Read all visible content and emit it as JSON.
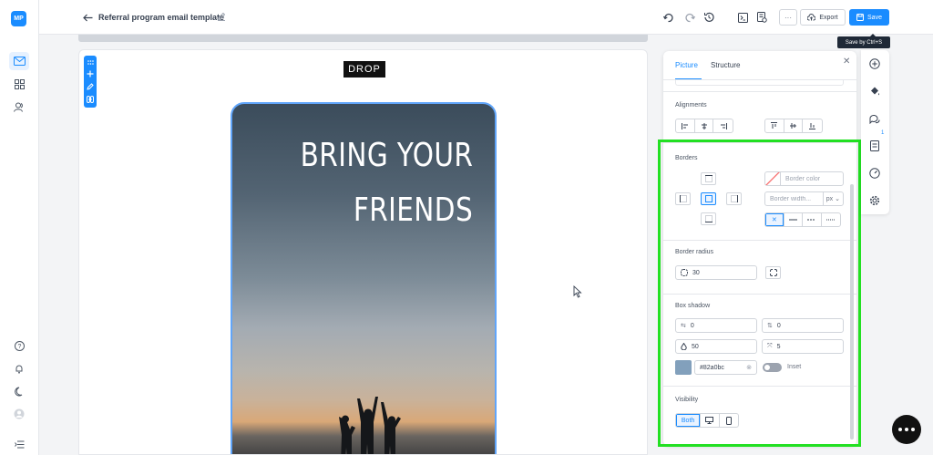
{
  "app": {
    "logo": "MP"
  },
  "header": {
    "title": "Referral program email template",
    "more_label": "···",
    "export_label": "Export",
    "save_label": "Save",
    "save_tooltip": "Save by Ctrl+S"
  },
  "canvas": {
    "logo_text": "DROP",
    "hero_line1": "BRING YOUR",
    "hero_line2": "FRIENDS"
  },
  "panel": {
    "tabs": [
      {
        "label": "Picture",
        "active": true
      },
      {
        "label": "Structure",
        "active": false
      }
    ],
    "alignments_label": "Alignments",
    "borders": {
      "label": "Borders",
      "color_placeholder": "Border color",
      "width_placeholder": "Border width...",
      "unit": "px"
    },
    "border_radius": {
      "label": "Border radius",
      "value": "30"
    },
    "box_shadow": {
      "label": "Box shadow",
      "h_offset": "0",
      "v_offset": "0",
      "blur": "50",
      "spread": "5",
      "color": "#82a0bc",
      "inset_label": "Inset",
      "inset_on": false
    },
    "visibility": {
      "label": "Visibility",
      "options": [
        "Both",
        "desktop",
        "mobile"
      ],
      "selected": "Both"
    }
  },
  "tool_strip": {
    "badge_count": "1"
  },
  "colors": {
    "accent": "#1a8cff",
    "highlight": "#22e022",
    "shadow": "#82a0bc"
  }
}
